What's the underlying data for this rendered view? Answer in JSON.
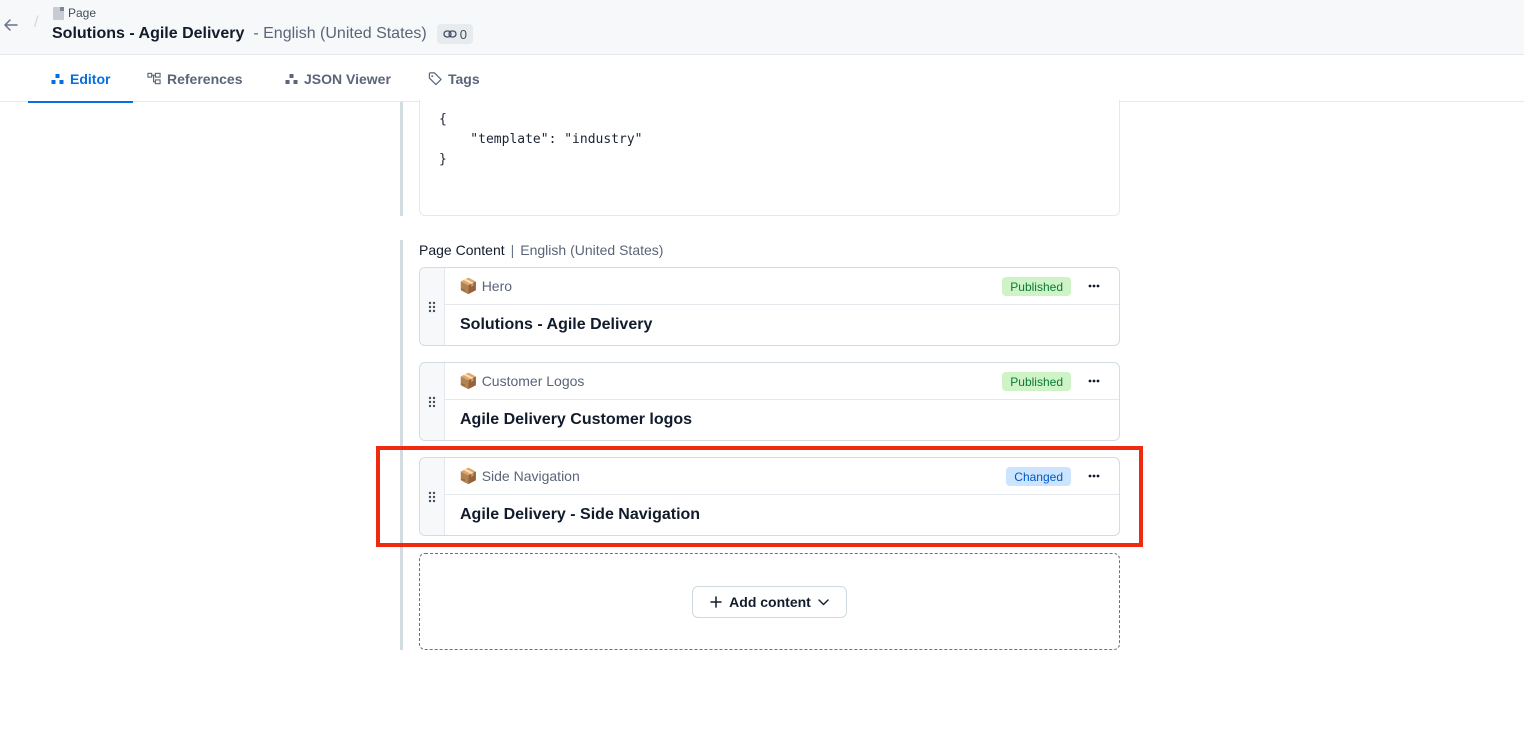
{
  "header": {
    "back_label": "Back",
    "entity_type": "Page",
    "title": "Solutions - Agile Delivery",
    "locale": "- English (United States)",
    "references_count": "0"
  },
  "tabs": [
    {
      "label": "Editor",
      "icon": "editor-icon",
      "active": true
    },
    {
      "label": "References",
      "icon": "references-icon",
      "active": false
    },
    {
      "label": "JSON Viewer",
      "icon": "json-viewer-icon",
      "active": false
    },
    {
      "label": "Tags",
      "icon": "tag-icon",
      "active": false
    }
  ],
  "code_field": {
    "lines": "{\n    \"template\": \"industry\"\n}"
  },
  "page_content": {
    "label": "Page Content",
    "separator": "|",
    "locale": "English (United States)",
    "entries": [
      {
        "content_type": "Hero",
        "title": "Solutions - Agile Delivery",
        "status": "Published"
      },
      {
        "content_type": "Customer Logos",
        "title": "Agile Delivery Customer logos",
        "status": "Published"
      },
      {
        "content_type": "Side Navigation",
        "title": "Agile Delivery - Side Navigation",
        "status": "Changed"
      }
    ],
    "content_type_icon": "📦",
    "add_content_label": "Add content"
  },
  "colors": {
    "accent": "#036fe3",
    "published_bg": "#cdf3c6",
    "published_text": "#0c7a34",
    "changed_bg": "#cce4fe",
    "changed_text": "#0059c8",
    "highlight": "#ee2b10"
  }
}
